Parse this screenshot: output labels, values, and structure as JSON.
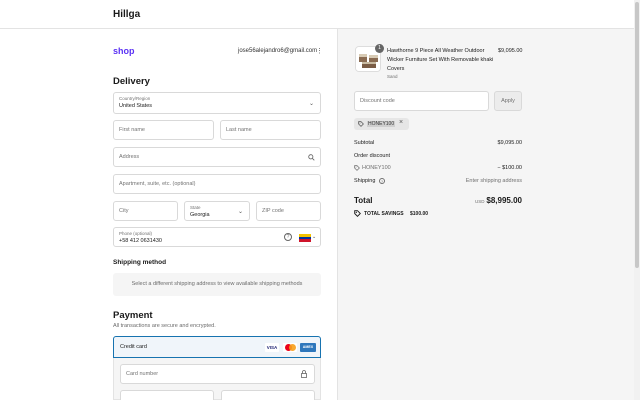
{
  "header": {
    "brand": "Hillga"
  },
  "account": {
    "shop_logo": "shop",
    "email": "jose56alejandro6@gmail.com"
  },
  "delivery": {
    "title": "Delivery",
    "country_label": "Country/Region",
    "country_value": "United States",
    "first_name_placeholder": "First name",
    "last_name_placeholder": "Last name",
    "address_placeholder": "Address",
    "apartment_placeholder": "Apartment, suite, etc. (optional)",
    "city_placeholder": "City",
    "state_label": "State",
    "state_value": "Georgia",
    "zip_placeholder": "ZIP code",
    "phone_label": "Phone (optional)",
    "phone_value": "+58 412 0631430"
  },
  "shipping": {
    "title": "Shipping method",
    "message": "Select a different shipping address to view available shipping methods"
  },
  "payment": {
    "title": "Payment",
    "subtitle": "All transactions are secure and encrypted.",
    "method_label": "Credit card",
    "card_brands": [
      "VISA",
      "",
      "AMEX"
    ],
    "card_number_placeholder": "Card number"
  },
  "order": {
    "product_name": "Hawthorne 9 Piece All Weather Outdoor Wicker Furniture Set With Removable khaki Covers",
    "product_variant": "Sand",
    "product_quantity": "1",
    "product_price": "$9,095.00",
    "discount_placeholder": "Discount code",
    "apply_label": "Apply",
    "applied_code": "HONEY100",
    "subtotal_label": "Subtotal",
    "subtotal_value": "$9,095.00",
    "order_discount_label": "Order discount",
    "discount_code": "HONEY100",
    "discount_value": "− $100.00",
    "shipping_label": "Shipping",
    "shipping_value": "Enter shipping address",
    "total_label": "Total",
    "currency": "USD",
    "total_value": "$8,995.00",
    "savings_label": "TOTAL SAVINGS",
    "savings_value": "$100.00"
  }
}
